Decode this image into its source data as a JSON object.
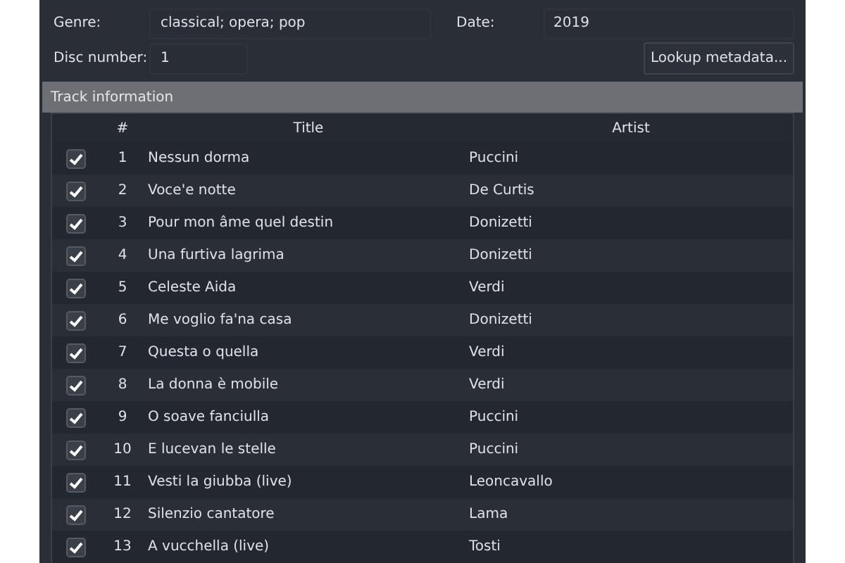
{
  "fields": [
    {
      "label": "Genre:",
      "value": "classical; opera; pop"
    },
    {
      "label": "Date:",
      "value": "2019"
    },
    {
      "label": "Disc number:",
      "value": "1"
    }
  ],
  "lookup_button": "Lookup metadata...",
  "section_title": "Track information",
  "table": {
    "columns": [
      "#",
      "Title",
      "Artist"
    ],
    "rows": [
      {
        "checked": true,
        "number": "1",
        "title": "Nessun dorma",
        "artist": "Puccini"
      },
      {
        "checked": true,
        "number": "2",
        "title": "Voce'e notte",
        "artist": "De Curtis"
      },
      {
        "checked": true,
        "number": "3",
        "title": "Pour mon âme quel destin",
        "artist": "Donizetti"
      },
      {
        "checked": true,
        "number": "4",
        "title": "Una furtiva lagrima",
        "artist": "Donizetti"
      },
      {
        "checked": true,
        "number": "5",
        "title": "Celeste Aida",
        "artist": "Verdi"
      },
      {
        "checked": true,
        "number": "6",
        "title": "Me voglio fa'na casa",
        "artist": "Donizetti"
      },
      {
        "checked": true,
        "number": "7",
        "title": "Questa o quella",
        "artist": "Verdi"
      },
      {
        "checked": true,
        "number": "8",
        "title": "La donna è mobile",
        "artist": "Verdi"
      },
      {
        "checked": true,
        "number": "9",
        "title": "O soave fanciulla",
        "artist": "Puccini"
      },
      {
        "checked": true,
        "number": "10",
        "title": "E lucevan le stelle",
        "artist": "Puccini"
      },
      {
        "checked": true,
        "number": "11",
        "title": "Vesti la giubba (live)",
        "artist": "Leoncavallo"
      },
      {
        "checked": true,
        "number": "12",
        "title": "Silenzio cantatore",
        "artist": "Lama"
      },
      {
        "checked": true,
        "number": "13",
        "title": "A vucchella (live)",
        "artist": "Tosti"
      }
    ]
  }
}
